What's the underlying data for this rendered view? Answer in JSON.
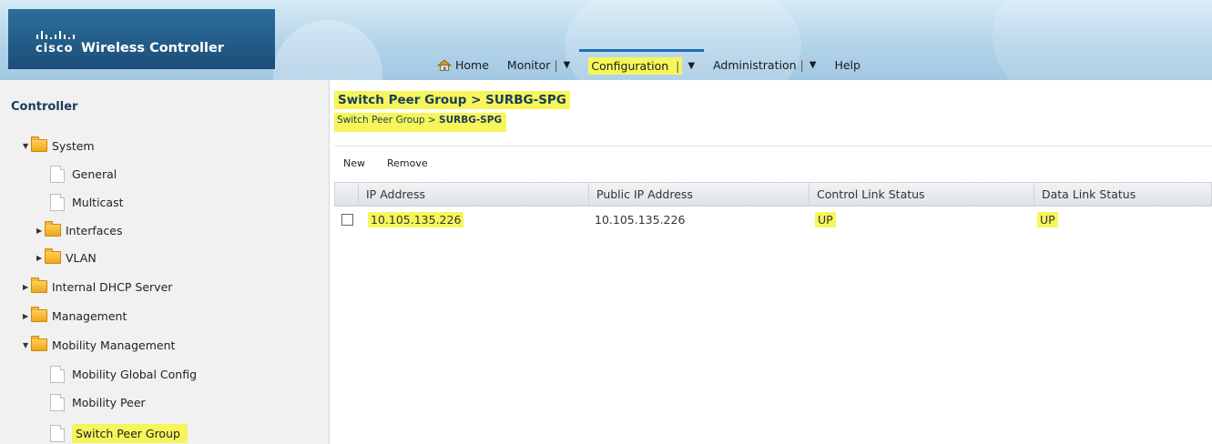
{
  "header": {
    "logo_word": "cisco",
    "app_title": "Wireless Controller",
    "home_icon": "home-icon",
    "nav": {
      "home": "Home",
      "monitor": "Monitor",
      "configuration": "Configuration",
      "administration": "Administration",
      "help": "Help"
    }
  },
  "sidebar": {
    "title": "Controller",
    "items": [
      {
        "label": "System"
      },
      {
        "label": "General"
      },
      {
        "label": "Multicast"
      },
      {
        "label": "Interfaces"
      },
      {
        "label": "VLAN"
      },
      {
        "label": "Internal DHCP Server"
      },
      {
        "label": "Management"
      },
      {
        "label": "Mobility Management"
      },
      {
        "label": "Mobility Global Config"
      },
      {
        "label": "Mobility Peer"
      },
      {
        "label": "Switch Peer Group"
      }
    ]
  },
  "main": {
    "title": "Switch Peer Group > SURBG-SPG",
    "breadcrumb": {
      "prefix": "Switch Peer Group > ",
      "current": "SURBG-SPG"
    },
    "toolbar": {
      "new": "New",
      "remove": "Remove"
    },
    "table": {
      "columns": [
        "IP Address",
        "Public IP Address",
        "Control Link Status",
        "Data Link Status"
      ],
      "rows": [
        {
          "ip": "10.105.135.226",
          "public_ip": "10.105.135.226",
          "control": "UP",
          "data": "UP"
        }
      ]
    }
  },
  "colors": {
    "highlight": "#f6f65b",
    "header_blue": "#1c4e78",
    "title_navy": "#1c3b5a"
  }
}
